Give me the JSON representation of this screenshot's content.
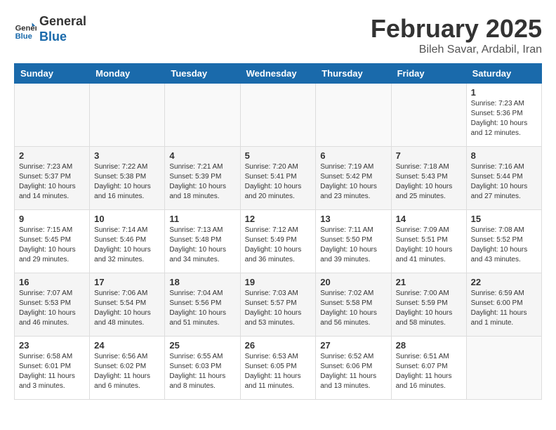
{
  "header": {
    "logo_line1": "General",
    "logo_line2": "Blue",
    "title": "February 2025",
    "subtitle": "Bileh Savar, Ardabil, Iran"
  },
  "days_of_week": [
    "Sunday",
    "Monday",
    "Tuesday",
    "Wednesday",
    "Thursday",
    "Friday",
    "Saturday"
  ],
  "weeks": [
    [
      {
        "day": "",
        "info": ""
      },
      {
        "day": "",
        "info": ""
      },
      {
        "day": "",
        "info": ""
      },
      {
        "day": "",
        "info": ""
      },
      {
        "day": "",
        "info": ""
      },
      {
        "day": "",
        "info": ""
      },
      {
        "day": "1",
        "info": "Sunrise: 7:23 AM\nSunset: 5:36 PM\nDaylight: 10 hours and 12 minutes."
      }
    ],
    [
      {
        "day": "2",
        "info": "Sunrise: 7:23 AM\nSunset: 5:37 PM\nDaylight: 10 hours and 14 minutes."
      },
      {
        "day": "3",
        "info": "Sunrise: 7:22 AM\nSunset: 5:38 PM\nDaylight: 10 hours and 16 minutes."
      },
      {
        "day": "4",
        "info": "Sunrise: 7:21 AM\nSunset: 5:39 PM\nDaylight: 10 hours and 18 minutes."
      },
      {
        "day": "5",
        "info": "Sunrise: 7:20 AM\nSunset: 5:41 PM\nDaylight: 10 hours and 20 minutes."
      },
      {
        "day": "6",
        "info": "Sunrise: 7:19 AM\nSunset: 5:42 PM\nDaylight: 10 hours and 23 minutes."
      },
      {
        "day": "7",
        "info": "Sunrise: 7:18 AM\nSunset: 5:43 PM\nDaylight: 10 hours and 25 minutes."
      },
      {
        "day": "8",
        "info": "Sunrise: 7:16 AM\nSunset: 5:44 PM\nDaylight: 10 hours and 27 minutes."
      }
    ],
    [
      {
        "day": "9",
        "info": "Sunrise: 7:15 AM\nSunset: 5:45 PM\nDaylight: 10 hours and 29 minutes."
      },
      {
        "day": "10",
        "info": "Sunrise: 7:14 AM\nSunset: 5:46 PM\nDaylight: 10 hours and 32 minutes."
      },
      {
        "day": "11",
        "info": "Sunrise: 7:13 AM\nSunset: 5:48 PM\nDaylight: 10 hours and 34 minutes."
      },
      {
        "day": "12",
        "info": "Sunrise: 7:12 AM\nSunset: 5:49 PM\nDaylight: 10 hours and 36 minutes."
      },
      {
        "day": "13",
        "info": "Sunrise: 7:11 AM\nSunset: 5:50 PM\nDaylight: 10 hours and 39 minutes."
      },
      {
        "day": "14",
        "info": "Sunrise: 7:09 AM\nSunset: 5:51 PM\nDaylight: 10 hours and 41 minutes."
      },
      {
        "day": "15",
        "info": "Sunrise: 7:08 AM\nSunset: 5:52 PM\nDaylight: 10 hours and 43 minutes."
      }
    ],
    [
      {
        "day": "16",
        "info": "Sunrise: 7:07 AM\nSunset: 5:53 PM\nDaylight: 10 hours and 46 minutes."
      },
      {
        "day": "17",
        "info": "Sunrise: 7:06 AM\nSunset: 5:54 PM\nDaylight: 10 hours and 48 minutes."
      },
      {
        "day": "18",
        "info": "Sunrise: 7:04 AM\nSunset: 5:56 PM\nDaylight: 10 hours and 51 minutes."
      },
      {
        "day": "19",
        "info": "Sunrise: 7:03 AM\nSunset: 5:57 PM\nDaylight: 10 hours and 53 minutes."
      },
      {
        "day": "20",
        "info": "Sunrise: 7:02 AM\nSunset: 5:58 PM\nDaylight: 10 hours and 56 minutes."
      },
      {
        "day": "21",
        "info": "Sunrise: 7:00 AM\nSunset: 5:59 PM\nDaylight: 10 hours and 58 minutes."
      },
      {
        "day": "22",
        "info": "Sunrise: 6:59 AM\nSunset: 6:00 PM\nDaylight: 11 hours and 1 minute."
      }
    ],
    [
      {
        "day": "23",
        "info": "Sunrise: 6:58 AM\nSunset: 6:01 PM\nDaylight: 11 hours and 3 minutes."
      },
      {
        "day": "24",
        "info": "Sunrise: 6:56 AM\nSunset: 6:02 PM\nDaylight: 11 hours and 6 minutes."
      },
      {
        "day": "25",
        "info": "Sunrise: 6:55 AM\nSunset: 6:03 PM\nDaylight: 11 hours and 8 minutes."
      },
      {
        "day": "26",
        "info": "Sunrise: 6:53 AM\nSunset: 6:05 PM\nDaylight: 11 hours and 11 minutes."
      },
      {
        "day": "27",
        "info": "Sunrise: 6:52 AM\nSunset: 6:06 PM\nDaylight: 11 hours and 13 minutes."
      },
      {
        "day": "28",
        "info": "Sunrise: 6:51 AM\nSunset: 6:07 PM\nDaylight: 11 hours and 16 minutes."
      },
      {
        "day": "",
        "info": ""
      }
    ]
  ]
}
